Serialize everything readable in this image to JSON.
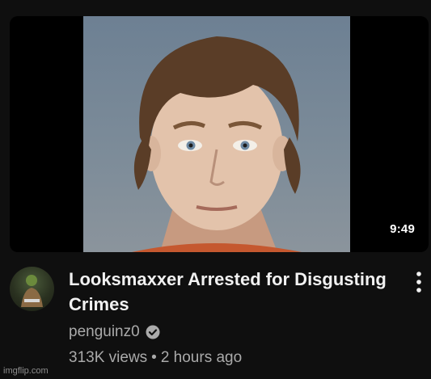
{
  "video": {
    "duration": "9:49",
    "title": "Looksmaxxer Arrested for Disgusting Crimes",
    "channel": "penguinz0",
    "views": "313K views",
    "separator": "•",
    "age": "2 hours ago"
  },
  "icons": {
    "verified": "verified-check-icon",
    "menu": "more-vertical-icon"
  },
  "watermark": "imgflip.com",
  "colors": {
    "background": "#0f0f0f",
    "title_text": "#f1f1f1",
    "secondary_text": "#aaaaaa"
  }
}
